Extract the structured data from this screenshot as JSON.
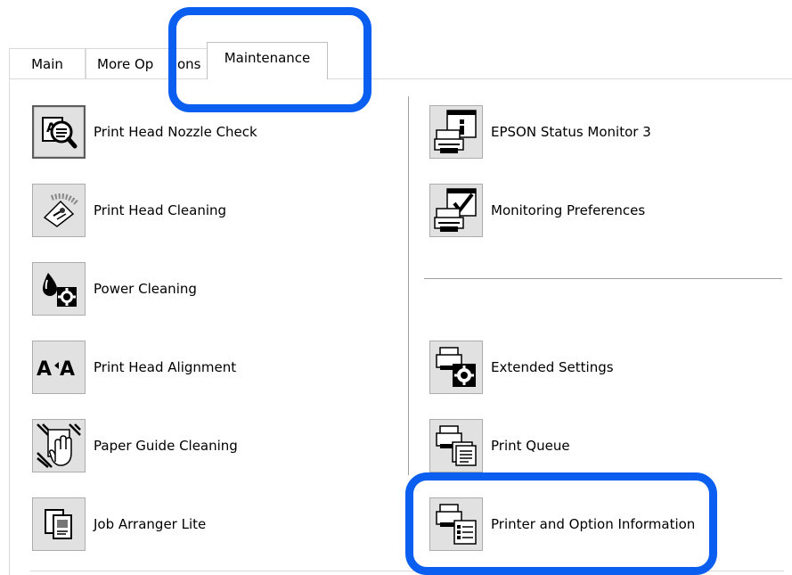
{
  "tabs": {
    "main": "Main",
    "more_options": "More Op",
    "more_options_tail": "ons",
    "maintenance": "Maintenance"
  },
  "left_items": [
    {
      "label": "Print Head Nozzle Check",
      "icon": "nozzle-check-icon"
    },
    {
      "label": "Print Head Cleaning",
      "icon": "head-cleaning-icon"
    },
    {
      "label": "Power Cleaning",
      "icon": "power-cleaning-icon"
    },
    {
      "label": "Print Head Alignment",
      "icon": "head-alignment-icon"
    },
    {
      "label": "Paper Guide Cleaning",
      "icon": "paper-guide-cleaning-icon"
    },
    {
      "label": "Job Arranger Lite",
      "icon": "job-arranger-icon"
    }
  ],
  "right_items": [
    {
      "label": "EPSON Status Monitor 3",
      "icon": "status-monitor-icon"
    },
    {
      "label": "Monitoring Preferences",
      "icon": "monitoring-preferences-icon"
    },
    {
      "label": "Extended Settings",
      "icon": "extended-settings-icon"
    },
    {
      "label": "Print Queue",
      "icon": "print-queue-icon"
    },
    {
      "label": "Printer and Option Information",
      "icon": "printer-information-icon"
    }
  ],
  "colors": {
    "highlight": "#0a5ef0",
    "icon_bg": "#e1e1e1",
    "separator": "#a0a0a0"
  }
}
